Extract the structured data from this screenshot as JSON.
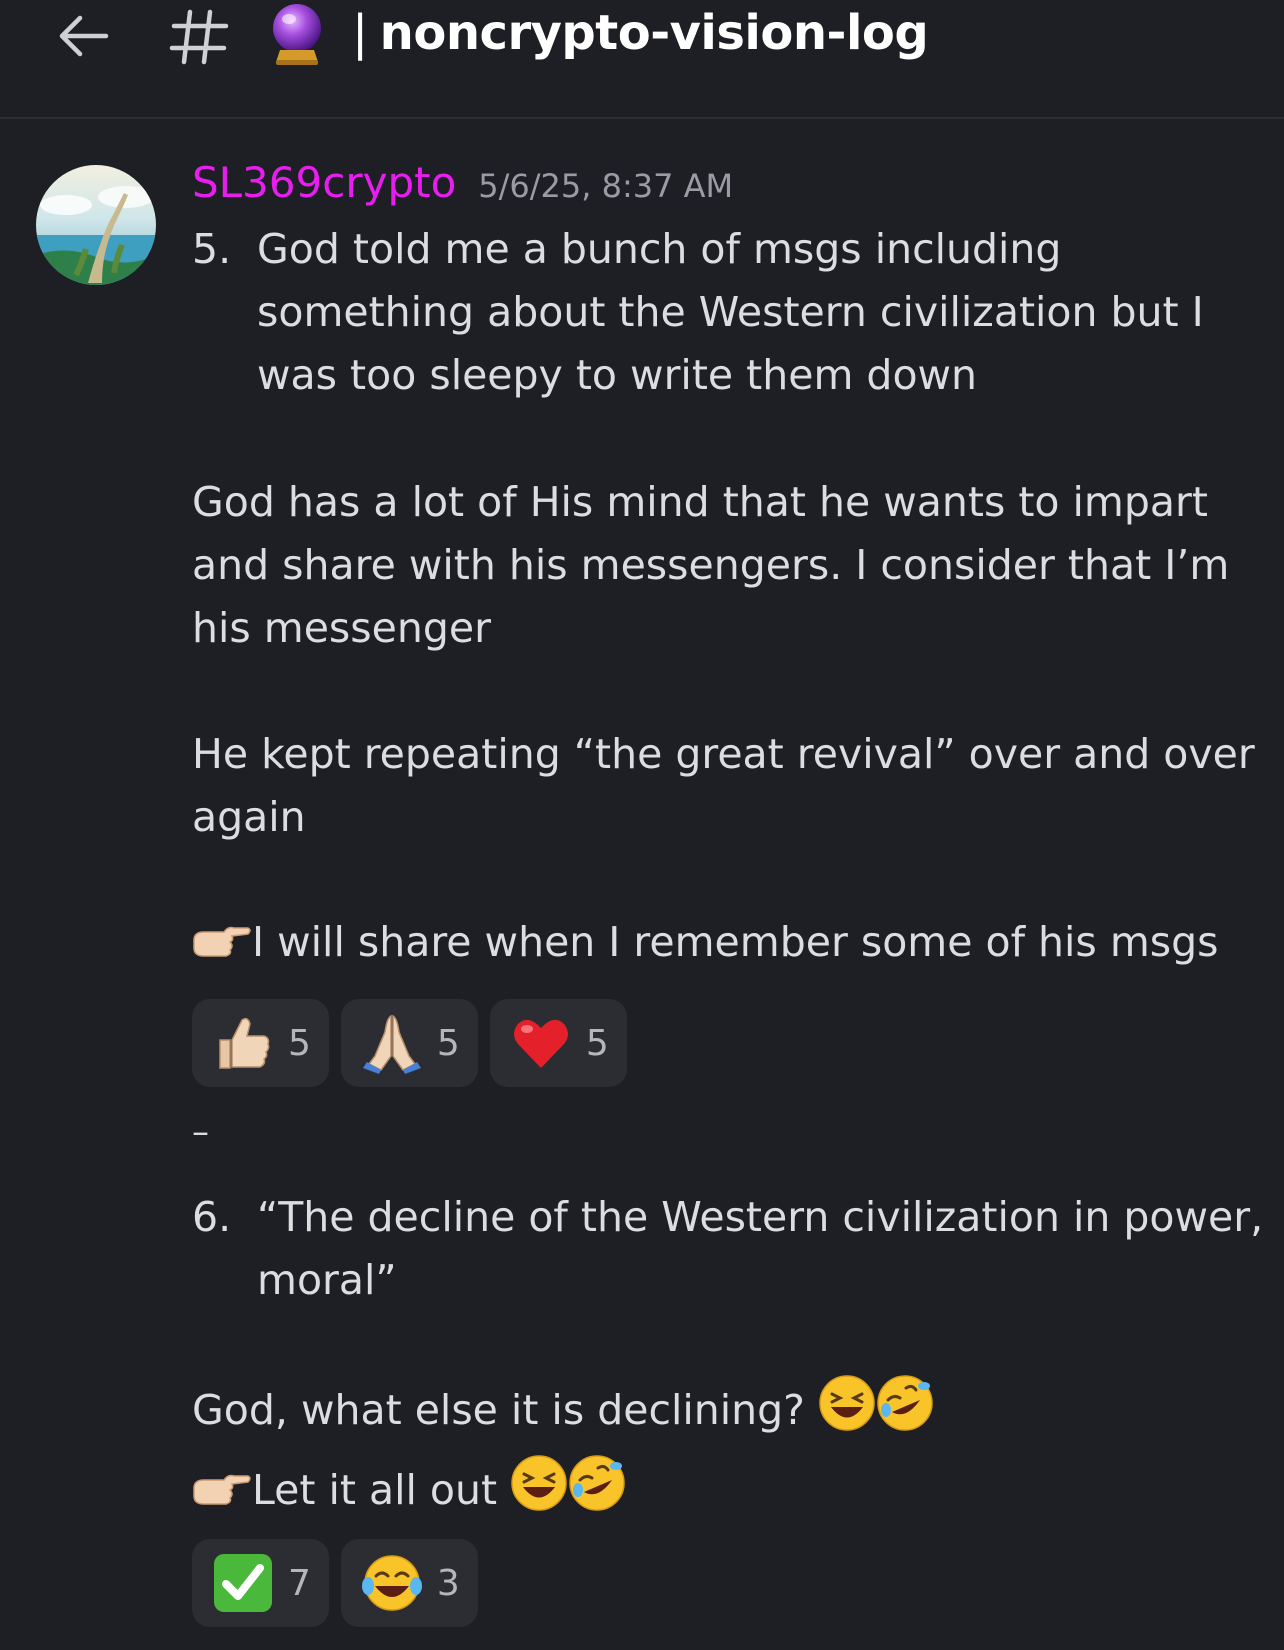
{
  "header": {
    "channel_emoji": "crystal-ball",
    "separator": "|",
    "title": "noncrypto-vision-log"
  },
  "message": {
    "author": "SL369crypto",
    "author_color": "#e81ef0",
    "timestamp": "5/6/25, 8:37 AM",
    "items": [
      {
        "number": "5.",
        "lines": [
          "God told me a bunch of msgs including",
          "something about the Western civilization but I",
          "was too sleepy to write them down"
        ]
      }
    ],
    "paragraph1": [
      "God has a lot of His mind that he wants to impart",
      "and share with his messengers. I consider that I’m",
      "his messenger"
    ],
    "paragraph2": [
      "He kept repeating “the great revival” over and over",
      "again"
    ],
    "pointer_line1": "I will share when I remember some of his msgs",
    "reactions1": [
      {
        "emoji": "thumbs-up",
        "count": "5"
      },
      {
        "emoji": "folded-hands",
        "count": "5"
      },
      {
        "emoji": "red-heart",
        "count": "5"
      }
    ],
    "dash": "–",
    "item6": {
      "number": "6.",
      "lines": [
        "“The decline of the Western civilization in power,",
        "moral”"
      ]
    },
    "question_line": "God, what else it is declining?",
    "pointer_line2": "Let it all out",
    "reactions2": [
      {
        "emoji": "check-mark",
        "count": "7"
      },
      {
        "emoji": "tears-of-joy",
        "count": "3"
      }
    ]
  }
}
